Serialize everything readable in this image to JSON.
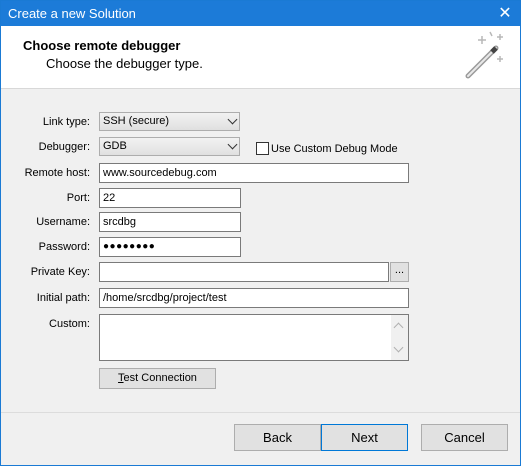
{
  "window": {
    "title": "Create a new Solution",
    "close_icon": "✕"
  },
  "header": {
    "title": "Choose remote debugger",
    "subtitle": "Choose the debugger type."
  },
  "form": {
    "link_type_label": "Link type:",
    "link_type_value": "SSH (secure)",
    "debugger_label": "Debugger:",
    "debugger_value": "GDB",
    "custom_debug_label": "Use Custom Debug Mode",
    "custom_debug_checked": false,
    "remote_host_label": "Remote host:",
    "remote_host_value": "www.sourcedebug.com",
    "port_label": "Port:",
    "port_value": "22",
    "username_label": "Username:",
    "username_value": "srcdbg",
    "password_label": "Password:",
    "password_value": "●●●●●●●●",
    "private_key_label": "Private Key:",
    "private_key_value": "",
    "browse_label": "...",
    "initial_path_label": "Initial path:",
    "initial_path_value": "/home/srcdbg/project/test",
    "custom_label": "Custom:",
    "custom_value": "",
    "test_connection_prefix": "",
    "test_connection_mnemonic": "T",
    "test_connection_rest": "est Connection"
  },
  "footer": {
    "back_label": "Back",
    "next_label": "Next",
    "cancel_label": "Cancel"
  }
}
